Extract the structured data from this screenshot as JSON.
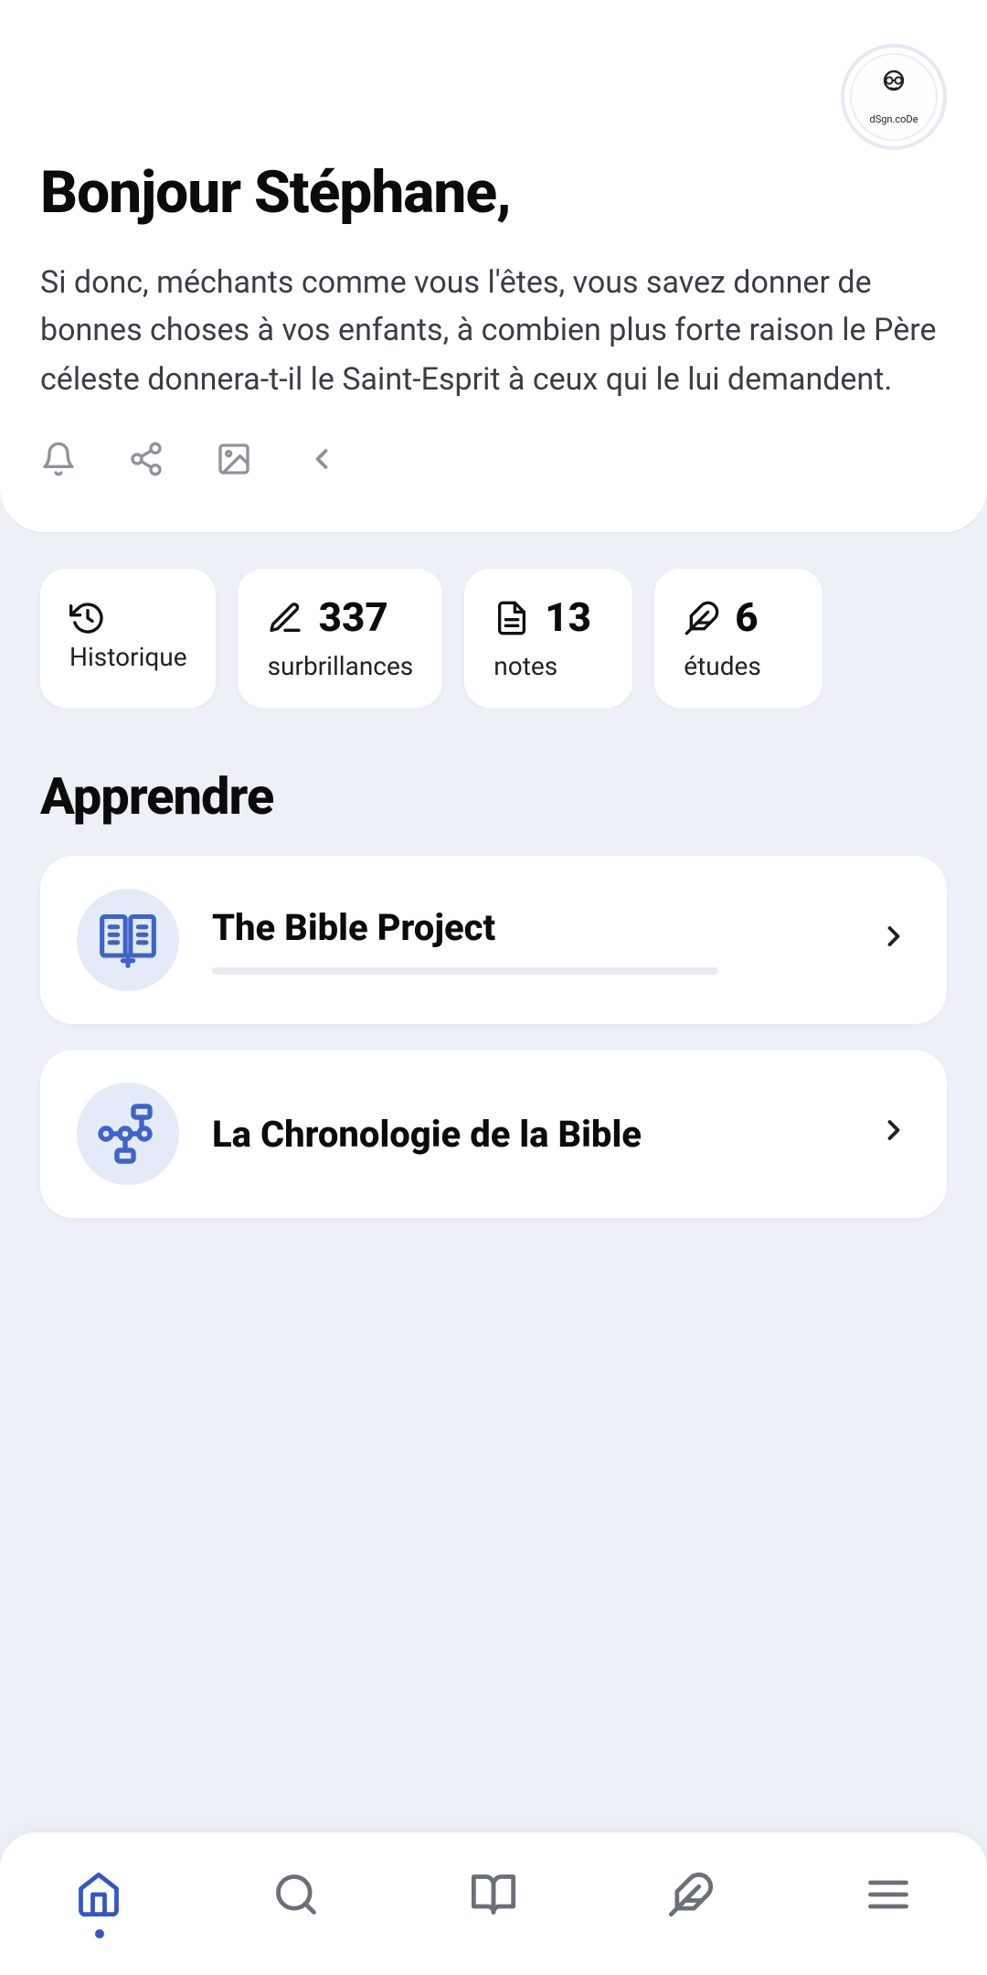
{
  "header": {
    "greeting": "Bonjour Stéphane,",
    "verse": "Si donc, méchants comme vous l'êtes, vous savez donner de bonnes choses à vos enfants, à combien plus forte raison le Père céleste donnera-t-il le Saint-Esprit à ceux qui le lui demandent.",
    "avatar_caption": "dSgn.coDe"
  },
  "stats": [
    {
      "icon": "history",
      "value": "",
      "label": "Historique"
    },
    {
      "icon": "edit",
      "value": "337",
      "label": "surbrillances"
    },
    {
      "icon": "note",
      "value": "13",
      "label": "notes"
    },
    {
      "icon": "feather",
      "value": "6",
      "label": "études"
    }
  ],
  "learn": {
    "title": "Apprendre",
    "items": [
      {
        "title": "The Bible Project",
        "icon": "bible",
        "has_progress": true
      },
      {
        "title": "La Chronologie de la Bible",
        "icon": "timeline",
        "has_progress": false
      }
    ]
  },
  "nav": {
    "active_index": 0
  }
}
